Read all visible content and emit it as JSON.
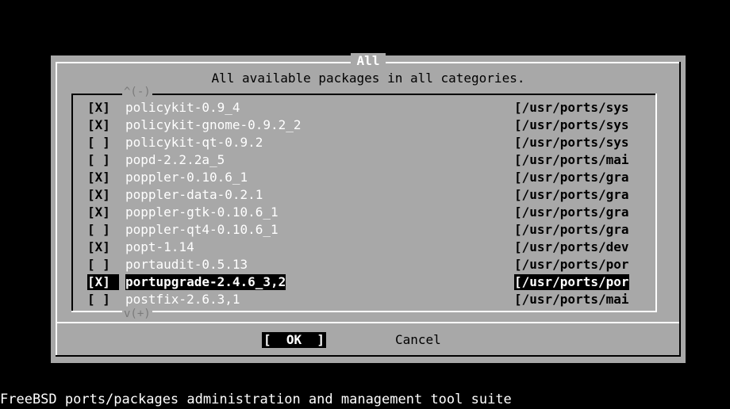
{
  "dialog": {
    "title": "All",
    "subtitle": "All available packages in all categories.",
    "scroll_up_indicator": "^(-)",
    "scroll_down_indicator": "v(+)",
    "items": [
      {
        "check": "[X]",
        "name": "policykit-0.9_4",
        "path": "[/usr/ports/sys"
      },
      {
        "check": "[X]",
        "name": "policykit-gnome-0.9.2_2",
        "path": "[/usr/ports/sys"
      },
      {
        "check": "[ ]",
        "name": "policykit-qt-0.9.2",
        "path": "[/usr/ports/sys"
      },
      {
        "check": "[ ]",
        "name": "popd-2.2.2a_5",
        "path": "[/usr/ports/mai"
      },
      {
        "check": "[X]",
        "name": "poppler-0.10.6_1",
        "path": "[/usr/ports/gra"
      },
      {
        "check": "[X]",
        "name": "poppler-data-0.2.1",
        "path": "[/usr/ports/gra"
      },
      {
        "check": "[X]",
        "name": "poppler-gtk-0.10.6_1",
        "path": "[/usr/ports/gra"
      },
      {
        "check": "[ ]",
        "name": "poppler-qt4-0.10.6_1",
        "path": "[/usr/ports/gra"
      },
      {
        "check": "[X]",
        "name": "popt-1.14",
        "path": "[/usr/ports/dev"
      },
      {
        "check": "[ ]",
        "name": "portaudit-0.5.13",
        "path": "[/usr/ports/por"
      },
      {
        "check": "[X]",
        "name": "portupgrade-2.4.6_3,2",
        "path": "[/usr/ports/por",
        "selected": true
      },
      {
        "check": "[ ]",
        "name": "postfix-2.6.3,1",
        "path": "[/usr/ports/mai"
      }
    ],
    "buttons": {
      "ok": "[  OK  ]",
      "cancel": "Cancel"
    }
  },
  "status_line": "FreeBSD ports/packages administration and management tool suite",
  "colors": {
    "background": "#000000",
    "dialog": "#a8a8a8",
    "highlight": "#000000",
    "text_light": "#ffffff"
  }
}
